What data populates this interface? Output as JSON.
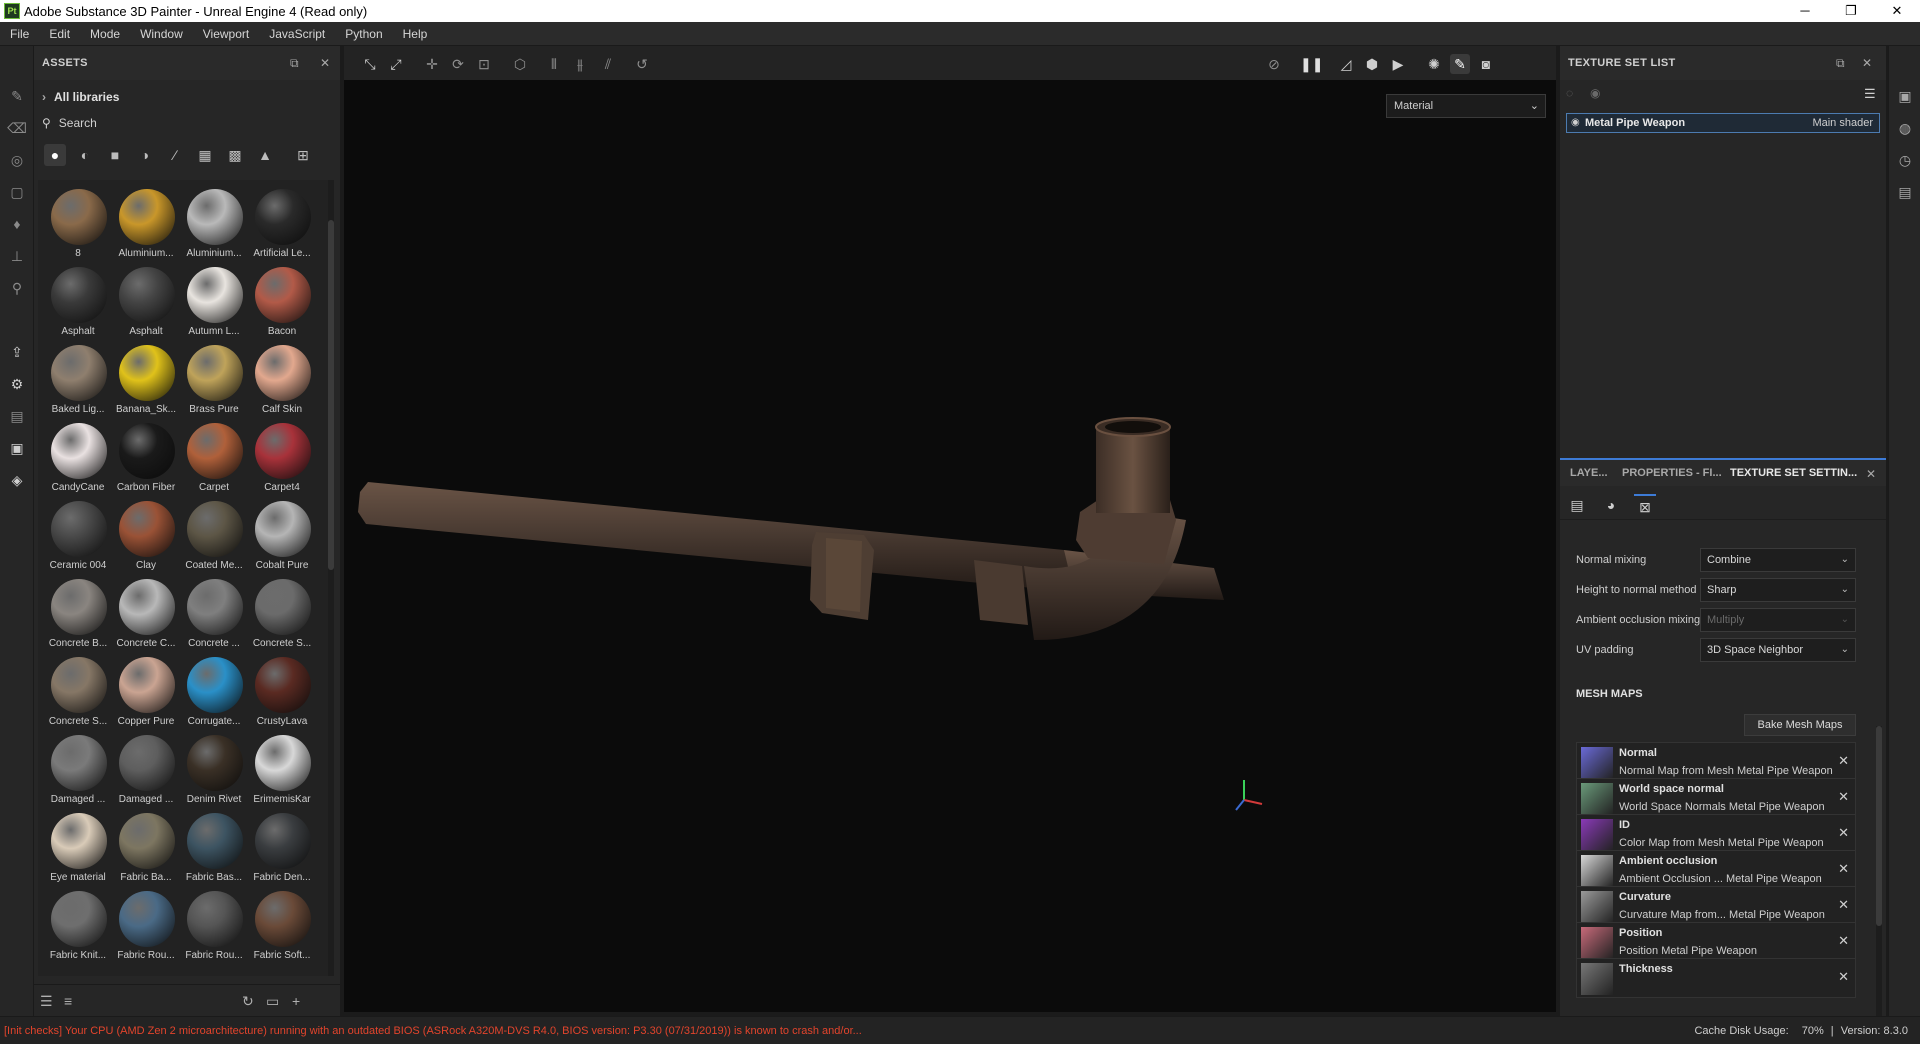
{
  "window": {
    "title": "Adobe Substance 3D Painter - Unreal Engine 4 (Read only)",
    "app_badge": "Pt",
    "minimize": "─",
    "maximize": "❐",
    "close": "✕"
  },
  "menu": [
    "File",
    "Edit",
    "Mode",
    "Window",
    "Viewport",
    "JavaScript",
    "Python",
    "Help"
  ],
  "assets": {
    "title": "ASSETS",
    "all_libraries": "All libraries",
    "search_placeholder": "Search",
    "items": [
      {
        "label": "8",
        "color": "#8a6a4a"
      },
      {
        "label": "Aluminium...",
        "color": "#c9972a"
      },
      {
        "label": "Aluminium...",
        "color": "#b9b9b9"
      },
      {
        "label": "Artificial Le...",
        "color": "#2a2a2a"
      },
      {
        "label": "Asphalt",
        "color": "#3a3a3a"
      },
      {
        "label": "Asphalt",
        "color": "#444444"
      },
      {
        "label": "Autumn L...",
        "color": "#e8e4df"
      },
      {
        "label": "Bacon",
        "color": "#b25a48"
      },
      {
        "label": "Baked Lig...",
        "color": "#8f7f6e"
      },
      {
        "label": "Banana_Sk...",
        "color": "#e0c21a"
      },
      {
        "label": "Brass Pure",
        "color": "#bfa35a"
      },
      {
        "label": "Calf Skin",
        "color": "#e2a88e"
      },
      {
        "label": "CandyCane",
        "color": "#e9e1e1"
      },
      {
        "label": "Carbon Fiber",
        "color": "#1a1a1a"
      },
      {
        "label": "Carpet",
        "color": "#b0603a"
      },
      {
        "label": "Carpet4",
        "color": "#a8323a"
      },
      {
        "label": "Ceramic 004",
        "color": "#4a4a4a"
      },
      {
        "label": "Clay",
        "color": "#9a5236"
      },
      {
        "label": "Coated Me...",
        "color": "#5d5646"
      },
      {
        "label": "Cobalt Pure",
        "color": "#b5b5b5"
      },
      {
        "label": "Concrete B...",
        "color": "#8a8580"
      },
      {
        "label": "Concrete C...",
        "color": "#b8b8b8"
      },
      {
        "label": "Concrete ...",
        "color": "#7f7f7f"
      },
      {
        "label": "Concrete S...",
        "color": "#6b6b6b"
      },
      {
        "label": "Concrete S...",
        "color": "#867766"
      },
      {
        "label": "Copper Pure",
        "color": "#caa492"
      },
      {
        "label": "Corrugate...",
        "color": "#2a90c8"
      },
      {
        "label": "CrustyLava",
        "color": "#5a2a22"
      },
      {
        "label": "Damaged ...",
        "color": "#7a7a7a"
      },
      {
        "label": "Damaged ...",
        "color": "#5e5e5e"
      },
      {
        "label": "Denim Rivet",
        "color": "#3a3026"
      },
      {
        "label": "ErimemisKar",
        "color": "#d8d8d8"
      },
      {
        "label": "Eye material",
        "color": "#d9cbb8"
      },
      {
        "label": "Fabric Ba...",
        "color": "#7d7661"
      },
      {
        "label": "Fabric Bas...",
        "color": "#3d5462"
      },
      {
        "label": "Fabric Den...",
        "color": "#3a3d40"
      },
      {
        "label": "Fabric Knit...",
        "color": "#6e6e6e"
      },
      {
        "label": "Fabric Rou...",
        "color": "#4a6a86"
      },
      {
        "label": "Fabric Rou...",
        "color": "#555555"
      },
      {
        "label": "Fabric Soft...",
        "color": "#6a4a38"
      }
    ]
  },
  "viewport": {
    "render_mode": "Material"
  },
  "texture_set_list": {
    "title": "TEXTURE SET LIST",
    "item_name": "Metal Pipe Weapon",
    "item_shader": "Main shader"
  },
  "tabs": [
    "LAYE...",
    "PROPERTIES - FI...",
    "TEXTURE SET SETTIN..."
  ],
  "settings": [
    {
      "label": "Normal mixing",
      "value": "Combine",
      "disabled": false
    },
    {
      "label": "Height to normal method",
      "value": "Sharp",
      "disabled": false
    },
    {
      "label": "Ambient occlusion mixing",
      "value": "Multiply",
      "disabled": true
    },
    {
      "label": "UV padding",
      "value": "3D Space Neighbor",
      "disabled": false
    }
  ],
  "mesh_maps": {
    "title": "MESH MAPS",
    "bake_button": "Bake Mesh Maps",
    "items": [
      {
        "name": "Normal",
        "source": "Normal Map from Mesh Metal Pipe Weapon",
        "color": "#6a6ad8"
      },
      {
        "name": "World space normal",
        "source": "World Space Normals Metal Pipe Weapon",
        "color": "#6a9a7a"
      },
      {
        "name": "ID",
        "source": "Color Map from Mesh Metal Pipe Weapon",
        "color": "#8a3ab8"
      },
      {
        "name": "Ambient occlusion",
        "source": "Ambient Occlusion ... Metal Pipe Weapon",
        "color": "#d8d8d8"
      },
      {
        "name": "Curvature",
        "source": "Curvature Map from... Metal Pipe Weapon",
        "color": "#9a9a9a"
      },
      {
        "name": "Position",
        "source": "Position Metal Pipe Weapon",
        "color": "#c86a7a"
      },
      {
        "name": "Thickness",
        "source": "",
        "color": "#777777"
      }
    ]
  },
  "status": {
    "warning": "[Init checks] Your CPU (AMD Zen 2 microarchitecture) running with an outdated BIOS (ASRock A320M-DVS R4.0, BIOS version: P3.30 (07/31/2019)) is known to crash and/or...",
    "cache": "Cache Disk Usage:",
    "cache_value": "70%",
    "version": "Version: 8.3.0"
  }
}
